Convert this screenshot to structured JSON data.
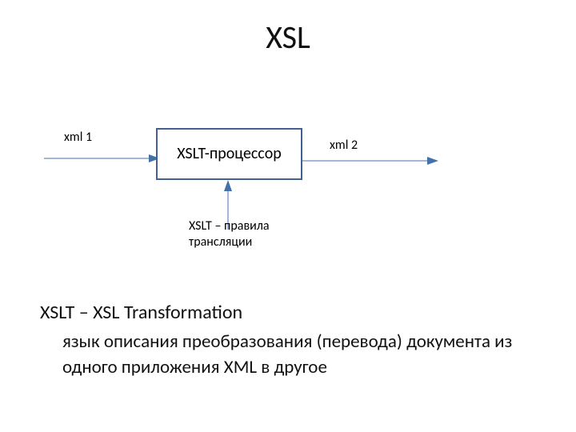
{
  "title": "XSL",
  "diagram": {
    "input_label": "xml 1",
    "output_label": "xml 2",
    "box_label": "XSLT-процессор",
    "rules_label_line1": "XSLT – правила",
    "rules_label_line2": "трансляции"
  },
  "body": {
    "line1": "XSLT – XSL Transformation",
    "line2": "язык описания преобразования (перевода) документа из одного приложения XML в другое"
  },
  "colors": {
    "arrow": "#4472a8",
    "box_border": "#426091"
  }
}
